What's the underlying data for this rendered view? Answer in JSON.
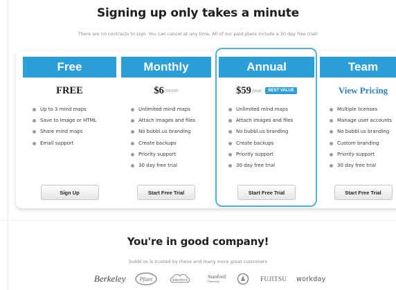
{
  "header": {
    "title": "Signing up only takes a minute",
    "subtitle": "There are no contracts to sign. You can cancel at any time. All of our paid plans include a 30 day free trial!"
  },
  "plans": [
    {
      "name": "Free",
      "price": "FREE",
      "features": [
        "Up to 3 mind maps",
        "Save to image or HTML",
        "Share mind maps",
        "Email support"
      ],
      "button": "Sign Up"
    },
    {
      "name": "Monthly",
      "price_amount": "$6",
      "price_period": "/month",
      "features": [
        "Unlimited mind maps",
        "Attach images and files",
        "No bubbl.us branding",
        "Create backups",
        "Priority support",
        "30 day free trial"
      ],
      "button": "Start Free Trial"
    },
    {
      "name": "Annual",
      "price_amount": "$59",
      "price_period": "/year",
      "badge": "BEST VALUE",
      "features": [
        "Unlimited mind maps",
        "Attach images and files",
        "No bubbl.us branding",
        "Create backups",
        "Priority support",
        "30 day free trial"
      ],
      "button": "Start Free Trial"
    },
    {
      "name": "Team",
      "price_link": "View Pricing",
      "features": [
        "Multiple licenses",
        "Manage user accounts",
        "No bubbl.us branding",
        "Custom branding",
        "Priority support",
        "30 day free trial"
      ],
      "button": "Start Free Trial"
    }
  ],
  "company": {
    "title": "You're in good company!",
    "subtitle": "bubbl.us is trusted by these and many more great customers",
    "logos": {
      "berkeley": "Berkeley",
      "pfizer": "Pfizer",
      "salesforce": "salesforce",
      "stanford": "Stanford",
      "stanford_sub": "University",
      "fujitsu": "FUJITSU",
      "workday": "workday"
    }
  },
  "colors": {
    "accent": "#2c9fd9",
    "highlight_border": "#4cb0e0",
    "link": "#2a80c8"
  }
}
